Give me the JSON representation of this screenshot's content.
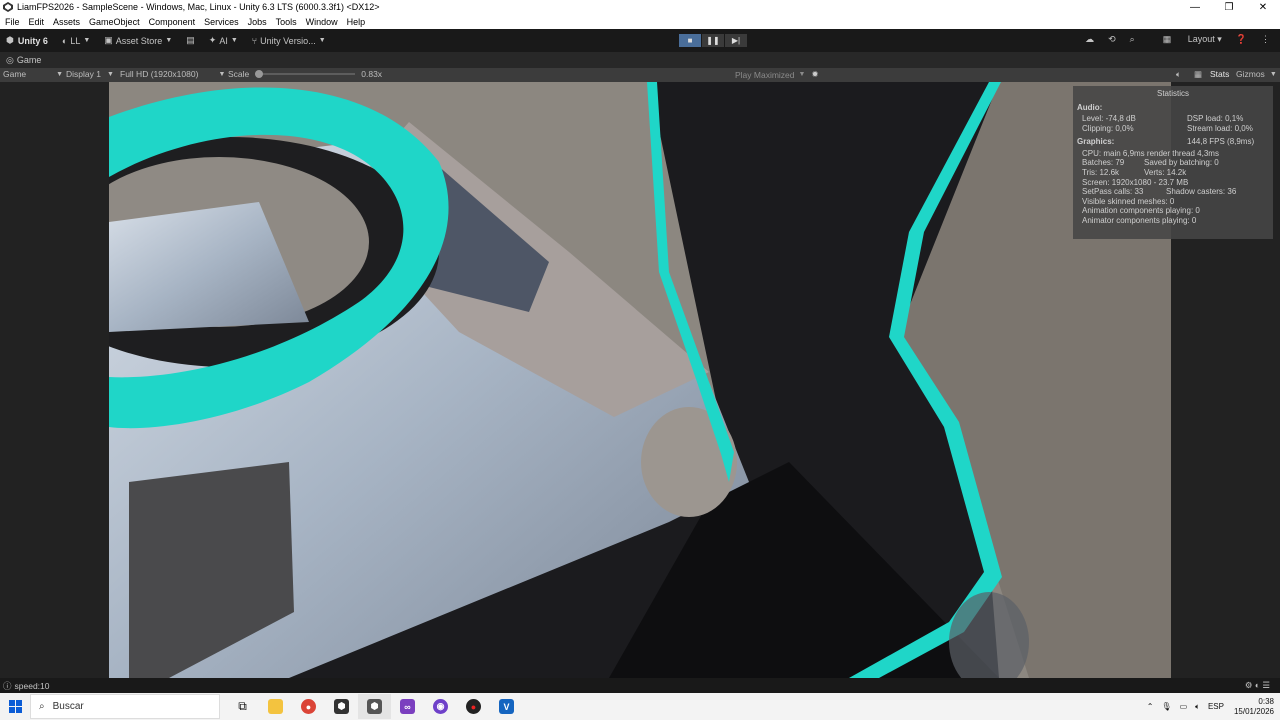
{
  "window": {
    "title": "LiamFPS2026 - SampleScene - Windows, Mac, Linux - Unity 6.3 LTS (6000.3.3f1) <DX12>",
    "buttons": [
      "—",
      "❐",
      "✕"
    ]
  },
  "menu": [
    "File",
    "Edit",
    "Assets",
    "GameObject",
    "Component",
    "Services",
    "Jobs",
    "Tools",
    "Window",
    "Help"
  ],
  "toolbar": {
    "unity_label": "Unity 6",
    "account": "LL",
    "asset_store": "Asset Store",
    "ai": "AI",
    "version_control": "Unity Versio...",
    "layout": "Layout"
  },
  "tab": {
    "label": "Game"
  },
  "game_toolbar": {
    "mode": "Game",
    "display": "Display 1",
    "resolution": "Full HD (1920x1080)",
    "scale_label": "Scale",
    "scale_value": "0.83x",
    "play_mode": "Play Maximized",
    "stats_label": "Stats",
    "gizmos_label": "Gizmos"
  },
  "stats": {
    "header": "Statistics",
    "audio_title": "Audio:",
    "level": "Level: -74,8 dB",
    "dsp_load": "DSP load: 0,1%",
    "clipping": "Clipping: 0,0%",
    "stream_load": "Stream load: 0,0%",
    "graphics_title": "Graphics:",
    "fps": "144,8 FPS (8,9ms)",
    "cpu": "CPU: main 6,9ms  render thread 4,3ms",
    "batches": "Batches: 79",
    "saved_batching": "Saved by batching: 0",
    "tris": "Tris: 12.6k",
    "verts": "Verts: 14.2k",
    "screen": "Screen: 1920x1080 - 23.7 MB",
    "setpass": "SetPass calls: 33",
    "shadow_casters": "Shadow casters: 36",
    "skinned": "Visible skinned meshes: 0",
    "animation": "Animation components playing: 0",
    "animator": "Animator components playing: 0"
  },
  "status": {
    "text": "speed:10"
  },
  "taskbar": {
    "search_placeholder": "Buscar",
    "lang": "ESP",
    "time": "0:38",
    "date": "15/01/2026"
  },
  "colors": {
    "accent_cyan": "#1fd6c8",
    "unity_bg": "#191919",
    "play_active": "#4a6e9a"
  }
}
